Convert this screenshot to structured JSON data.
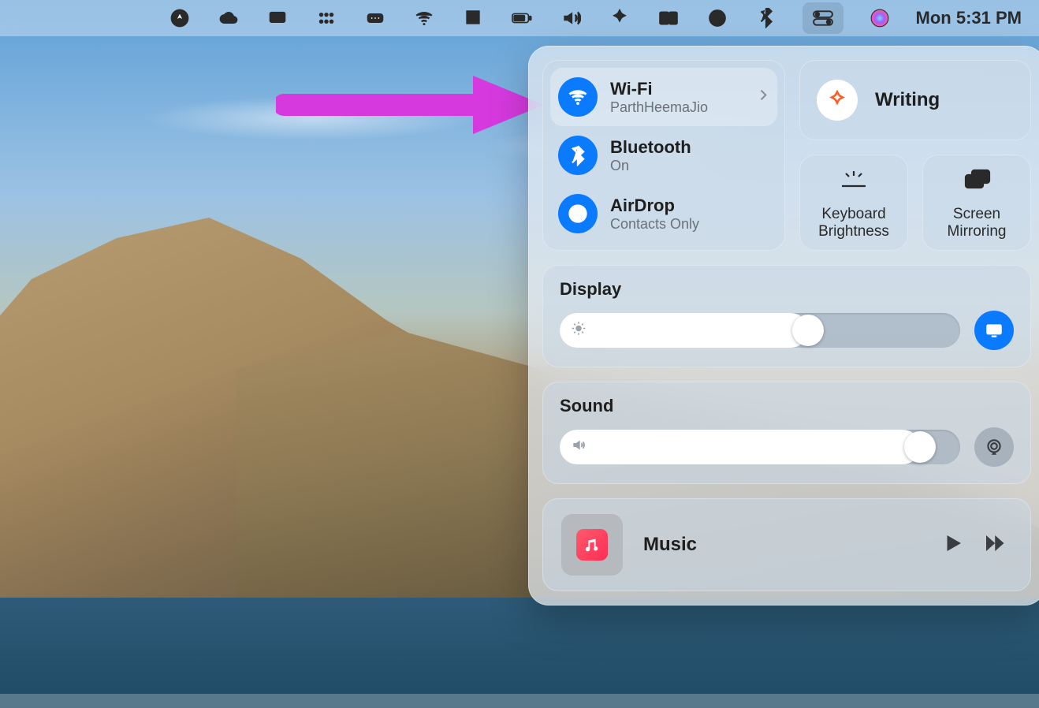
{
  "menubar": {
    "clock": "Mon 5:31 PM"
  },
  "cc": {
    "wifi": {
      "title": "Wi-Fi",
      "subtitle": "ParthHeemaJio"
    },
    "bluetooth": {
      "title": "Bluetooth",
      "subtitle": "On"
    },
    "airdrop": {
      "title": "AirDrop",
      "subtitle": "Contacts Only"
    },
    "focus": {
      "title": "Writing"
    },
    "tiles": {
      "keyboard_brightness": "Keyboard\nBrightness",
      "screen_mirroring": "Screen\nMirroring"
    },
    "display": {
      "title": "Display",
      "value_pct": 62
    },
    "sound": {
      "title": "Sound",
      "value_pct": 90
    },
    "music": {
      "title": "Music"
    }
  }
}
